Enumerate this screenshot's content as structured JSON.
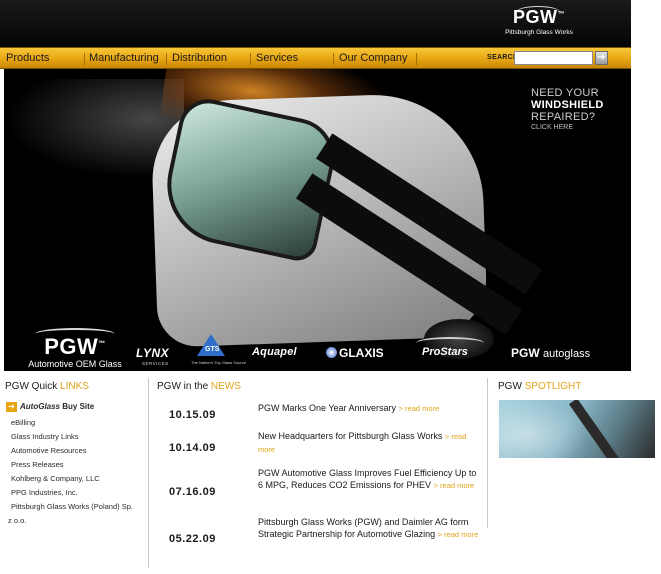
{
  "header": {
    "brand": {
      "mark": "PGW",
      "tm": "™",
      "subtitle": "Pittsburgh Glass Works"
    }
  },
  "nav": {
    "items": [
      {
        "label": "Products"
      },
      {
        "label": "Manufacturing"
      },
      {
        "label": "Distribution"
      },
      {
        "label": "Services"
      },
      {
        "label": "Our Company"
      }
    ],
    "search_label": "SEARCH",
    "search_value": "",
    "search_go": "➔"
  },
  "hero": {
    "promo": {
      "line1": "NEED YOUR",
      "line2": "WINDSHIELD",
      "line3": "REPAIRED?",
      "cta": "CLICK HERE"
    },
    "main_logo": {
      "mark": "PGW",
      "tm": "™",
      "subtitle": "Automotive OEM Glass"
    },
    "brand_logos": {
      "lynx": "LYNX",
      "lynx_sub": "SERVICES",
      "gts": "GTS",
      "gts_sub": "The Nation's Top Glass Source",
      "aquapel": "Aquapel",
      "glaxis": "GLAXIS",
      "prostars": "ProStars",
      "pgwauto_mark": "PGW",
      "pgwauto_word": "autoglass"
    }
  },
  "quick_links": {
    "title": "PGW Quick ",
    "title_highlight": "LINKS",
    "feature": {
      "arrow": "➔",
      "italic": "AutoGlass",
      "bold": "Buy Site"
    },
    "links": [
      "eBilling",
      "Glass Industry Links",
      "Automotive Resources",
      "Press Releases",
      "Kohlberg & Company, LLC",
      "PPG Industries, Inc.",
      "Pittsburgh Glass Works (Poland) Sp.",
      "z o.o."
    ]
  },
  "news": {
    "title": "PGW in the ",
    "title_highlight": "NEWS",
    "more_label": "> read more",
    "items": [
      {
        "date": "10.15.09",
        "text": "PGW Marks One Year Anniversary "
      },
      {
        "date": "10.14.09",
        "text": "New Headquarters for Pittsburgh Glass Works "
      },
      {
        "date": "07.16.09",
        "text": "PGW Automotive Glass Improves Fuel Efficiency Up to 6 MPG, Reduces CO2 Emissions for PHEV "
      },
      {
        "date": "05.22.09",
        "text": "Pittsburgh Glass Works (PGW) and Daimler AG form Strategic Partnership for Automotive Glazing "
      }
    ]
  },
  "spotlight": {
    "title": "PGW ",
    "title_highlight": "SPOTLIGHT"
  }
}
